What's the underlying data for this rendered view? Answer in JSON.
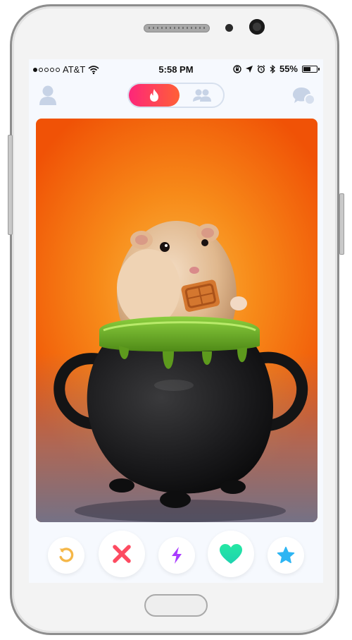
{
  "status_bar": {
    "carrier": "AT&T",
    "time": "5:58 PM",
    "battery_percent": "55%",
    "battery_level": 0.55
  },
  "navbar": {
    "left_icon": "profile-icon",
    "toggle_active_icon": "flame-icon",
    "toggle_inactive_icon": "group-icon",
    "right_icon": "chat-bubbles-icon"
  },
  "card": {
    "image_subject": "hamster in cauldron",
    "colors": {
      "bg_center": "#fbb640",
      "bg_edge": "#f05206"
    }
  },
  "actions": [
    {
      "name": "rewind-button",
      "icon": "rewind-icon",
      "color": "#f5b748"
    },
    {
      "name": "nope-button",
      "icon": "x-icon",
      "color": "#fd4b61"
    },
    {
      "name": "boost-button",
      "icon": "lightning-icon",
      "color": "#a93bff"
    },
    {
      "name": "like-button",
      "icon": "heart-icon",
      "color": "#1be4a6"
    },
    {
      "name": "super-like-button",
      "icon": "star-icon",
      "color": "#2db5f3"
    }
  ],
  "colors": {
    "brand_gradient_start": "#fd267a",
    "brand_gradient_end": "#ff6036",
    "inactive_icon": "#c7d3e6"
  }
}
